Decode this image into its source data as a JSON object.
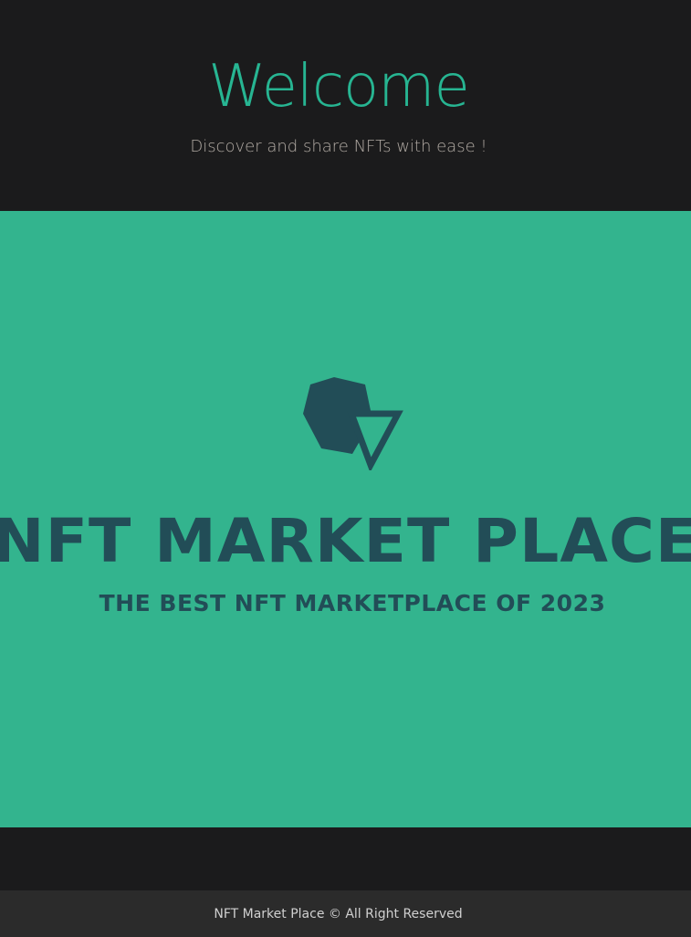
{
  "header": {
    "title": "Welcome",
    "tagline": "Discover and share NFTs with ease !"
  },
  "banner": {
    "logo_icon": "hexagon-triangle-logo-icon",
    "title": "NFT MARKET PLACE",
    "subtitle": "THE BEST NFT MARKETPLACE OF 2023"
  },
  "footer": {
    "copyright": "NFT Market Place © All Right Reserved"
  },
  "colors": {
    "background": "#1b1b1c",
    "accent": "#27b592",
    "banner_bg": "#33b48e",
    "brand_dark": "#224d57",
    "footer_bg": "#2b2b2b"
  }
}
